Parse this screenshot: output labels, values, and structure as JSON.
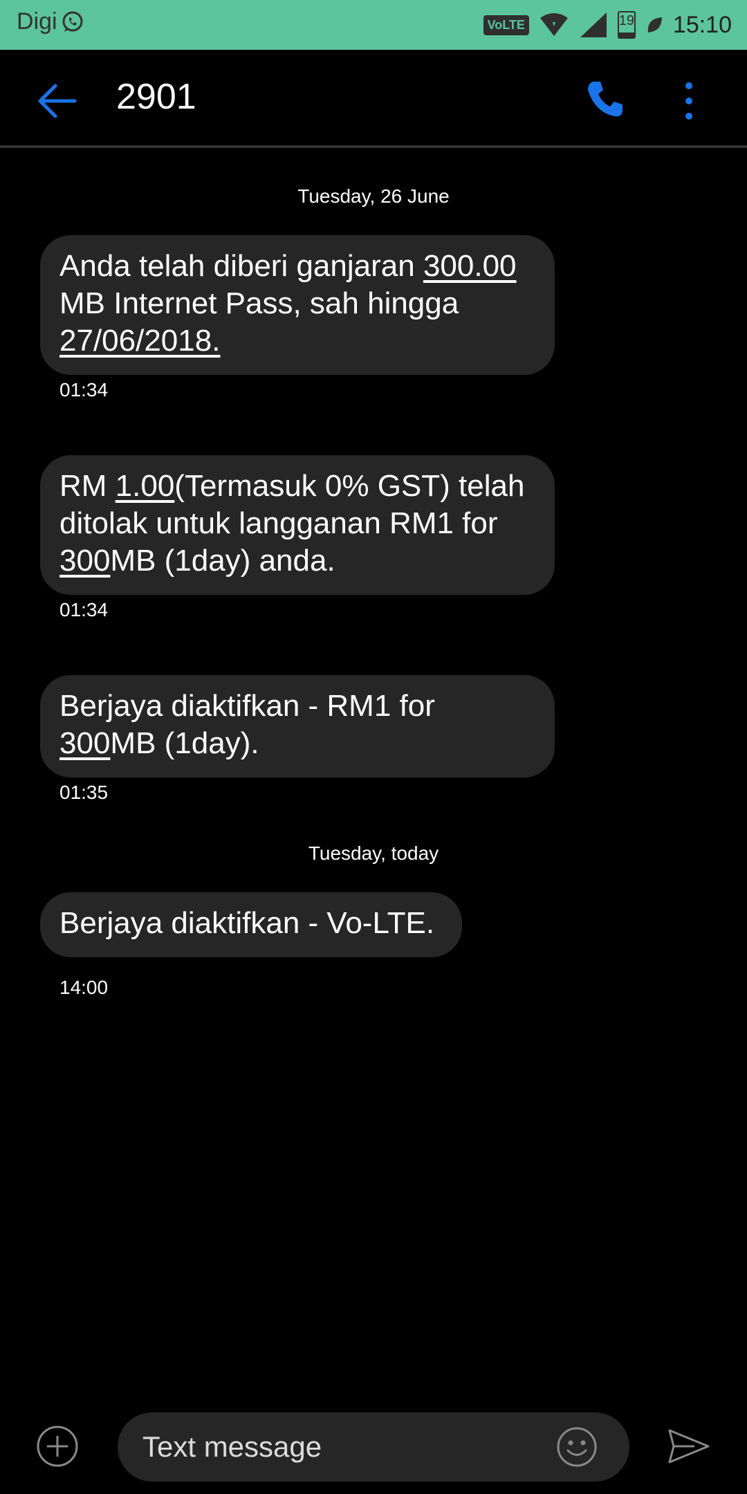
{
  "status_bar": {
    "carrier": "Digi",
    "volte": "VoLTE",
    "battery_level": "19",
    "battery_fraction": 0.19,
    "time": "15:10"
  },
  "header": {
    "title": "2901",
    "accent_color": "#1a73e8"
  },
  "conversation": {
    "date_separators": [
      "Tuesday, 26 June",
      "Tuesday, today"
    ],
    "messages": [
      {
        "parts": [
          "Anda telah diberi ganjaran ",
          "300.00",
          " MB Internet Pass, sah hingga ",
          "27/06/2018."
        ],
        "time": "01:34"
      },
      {
        "parts": [
          "RM ",
          "1.00",
          "(Termasuk 0% GST) telah ditolak untuk langganan RM1 for ",
          "300",
          "MB (1day) anda."
        ],
        "time": "01:34"
      },
      {
        "parts": [
          "Berjaya diaktifkan - RM1 for ",
          "300",
          "MB (1day)."
        ],
        "time": "01:35"
      },
      {
        "text": "Berjaya diaktifkan - Vo-LTE.",
        "time": "14:00"
      }
    ]
  },
  "compose": {
    "placeholder": "Text message"
  },
  "icons": {
    "back": "arrow-back-icon",
    "call": "phone-icon",
    "more": "more-vert-icon",
    "add": "add-circle-icon",
    "emoji": "emoji-icon",
    "send": "send-icon"
  }
}
